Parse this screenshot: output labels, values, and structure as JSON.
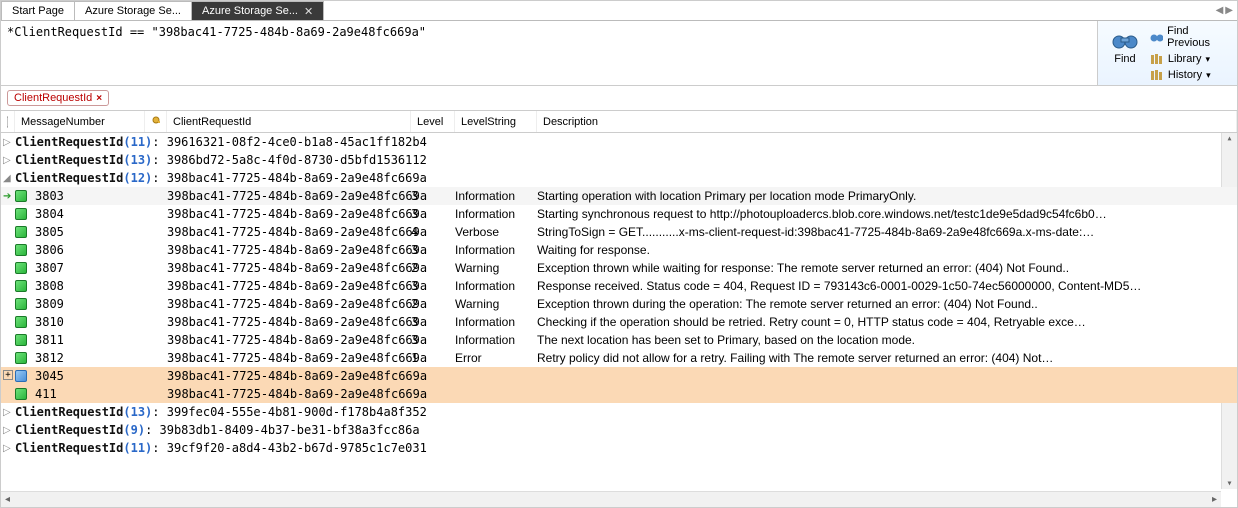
{
  "tabs": [
    {
      "label": "Start Page",
      "active": false
    },
    {
      "label": "Azure Storage Se...",
      "active": false
    },
    {
      "label": "Azure Storage Se...",
      "active": true
    }
  ],
  "query": "*ClientRequestId == \"398bac41-7725-484b-8a69-2a9e48fc669a\"",
  "sidepanel": {
    "find_label": "Find",
    "find_previous": "Find Previous",
    "library": "Library",
    "history": "History"
  },
  "filter_tag": "ClientRequestId",
  "columns": {
    "msgnum": "MessageNumber",
    "crid": "ClientRequestId",
    "level": "Level",
    "levelstr": "LevelString",
    "desc": "Description"
  },
  "groups_before": [
    {
      "label": "ClientRequestId",
      "count": "(11)",
      "value": "39616321-08f2-4ce0-b1a8-45ac1ff182b4"
    },
    {
      "label": "ClientRequestId",
      "count": "(13)",
      "value": "3986bd72-5a8c-4f0d-8730-d5bfd1536112"
    }
  ],
  "expanded_group": {
    "label": "ClientRequestId",
    "count": "(12)",
    "value": "398bac41-7725-484b-8a69-2a9e48fc669a"
  },
  "rows": [
    {
      "msgnum": "3803",
      "crid": "398bac41-7725-484b-8a69-2a9e48fc669a",
      "level": "3",
      "levelstr": "Information",
      "desc": "Starting operation with location Primary per location mode PrimaryOnly.",
      "alt": true,
      "arrow": true
    },
    {
      "msgnum": "3804",
      "crid": "398bac41-7725-484b-8a69-2a9e48fc669a",
      "level": "3",
      "levelstr": "Information",
      "desc": "Starting synchronous request to http://photouploadercs.blob.core.windows.net/testc1de9e5dad9c54fc6b0…"
    },
    {
      "msgnum": "3805",
      "crid": "398bac41-7725-484b-8a69-2a9e48fc669a",
      "level": "4",
      "levelstr": "Verbose",
      "desc": "StringToSign = GET...........x-ms-client-request-id:398bac41-7725-484b-8a69-2a9e48fc669a.x-ms-date:…"
    },
    {
      "msgnum": "3806",
      "crid": "398bac41-7725-484b-8a69-2a9e48fc669a",
      "level": "3",
      "levelstr": "Information",
      "desc": "Waiting for response."
    },
    {
      "msgnum": "3807",
      "crid": "398bac41-7725-484b-8a69-2a9e48fc669a",
      "level": "2",
      "levelstr": "Warning",
      "desc": "Exception thrown while waiting for response: The remote server returned an error: (404) Not Found.."
    },
    {
      "msgnum": "3808",
      "crid": "398bac41-7725-484b-8a69-2a9e48fc669a",
      "level": "3",
      "levelstr": "Information",
      "desc": "Response received. Status code = 404, Request ID = 793143c6-0001-0029-1c50-74ec56000000, Content-MD5…"
    },
    {
      "msgnum": "3809",
      "crid": "398bac41-7725-484b-8a69-2a9e48fc669a",
      "level": "2",
      "levelstr": "Warning",
      "desc": "Exception thrown during the operation: The remote server returned an error: (404) Not Found.."
    },
    {
      "msgnum": "3810",
      "crid": "398bac41-7725-484b-8a69-2a9e48fc669a",
      "level": "3",
      "levelstr": "Information",
      "desc": "Checking if the operation should be retried. Retry count = 0, HTTP status code = 404, Retryable exce…"
    },
    {
      "msgnum": "3811",
      "crid": "398bac41-7725-484b-8a69-2a9e48fc669a",
      "level": "3",
      "levelstr": "Information",
      "desc": "The next location has been set to Primary, based on the location mode."
    },
    {
      "msgnum": "3812",
      "crid": "398bac41-7725-484b-8a69-2a9e48fc669a",
      "level": "1",
      "levelstr": "Error",
      "desc": "Retry policy did not allow for a retry. Failing with The remote server returned an error: (404) Not…"
    },
    {
      "msgnum": "3045",
      "crid": "398bac41-7725-484b-8a69-2a9e48fc669a",
      "level": "",
      "levelstr": "",
      "desc": "",
      "hl": true,
      "icon": "blue",
      "plus": true
    },
    {
      "msgnum": "411",
      "crid": "398bac41-7725-484b-8a69-2a9e48fc669a",
      "level": "",
      "levelstr": "",
      "desc": "",
      "hl": true
    }
  ],
  "groups_after": [
    {
      "label": "ClientRequestId",
      "count": "(13)",
      "value": "399fec04-555e-4b81-900d-f178b4a8f352"
    },
    {
      "label": "ClientRequestId",
      "count": "(9)",
      "value": "39b83db1-8409-4b37-be31-bf38a3fcc86a"
    },
    {
      "label": "ClientRequestId",
      "count": "(11)",
      "value": "39cf9f20-a8d4-43b2-b67d-9785c1c7e031"
    }
  ]
}
